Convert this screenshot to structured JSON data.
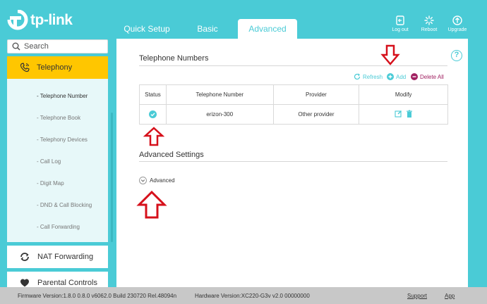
{
  "app": {
    "brand": "tp-link"
  },
  "header": {
    "tabs": [
      {
        "label": "Quick Setup",
        "active": false
      },
      {
        "label": "Basic",
        "active": false
      },
      {
        "label": "Advanced",
        "active": true
      }
    ],
    "actions": [
      {
        "label": "Log out",
        "icon": "logout-icon"
      },
      {
        "label": "Reboot",
        "icon": "reboot-icon"
      },
      {
        "label": "Upgrade",
        "icon": "upgrade-icon"
      }
    ]
  },
  "sidebar": {
    "search_placeholder": "Search",
    "active_item": {
      "label": "Telephony",
      "icon": "phone-icon"
    },
    "submenu": [
      {
        "label": "- Telephone Number",
        "current": true
      },
      {
        "label": "- Telephone Book",
        "current": false
      },
      {
        "label": "- Telephony Devices",
        "current": false
      },
      {
        "label": "- Call Log",
        "current": false
      },
      {
        "label": "- Digit Map",
        "current": false
      },
      {
        "label": "- DND & Call Blocking",
        "current": false
      },
      {
        "label": "- Call Forwarding",
        "current": false
      }
    ],
    "items": [
      {
        "label": "NAT Forwarding",
        "icon": "nat-forwarding-icon"
      },
      {
        "label": "Parental Controls",
        "icon": "parental-controls-icon"
      }
    ]
  },
  "main": {
    "telephone_section": {
      "title": "Telephone Numbers",
      "actions": {
        "refresh": "Refresh",
        "add": "Add",
        "delete_all": "Delete All"
      },
      "table": {
        "columns": [
          "Status",
          "Telephone Number",
          "Provider",
          "Modify"
        ],
        "rows": [
          {
            "status": "enabled",
            "number": "erizon-300",
            "provider": "Other provider"
          }
        ]
      }
    },
    "advanced_section": {
      "title": "Advanced Settings",
      "toggle_label": "Advanced"
    }
  },
  "footer": {
    "firmware": "Firmware Version:1.8.0 0.8.0 v6062.0 Build 230720 Rel.48094n",
    "hardware": "Hardware Version:XC220-G3v v2.0 00000000",
    "support": "Support",
    "app": "App"
  },
  "colors": {
    "accent": "#4acbd6",
    "active_menu": "#ffc600",
    "delete": "#a12262",
    "annotation_arrow": "#d6101b"
  }
}
